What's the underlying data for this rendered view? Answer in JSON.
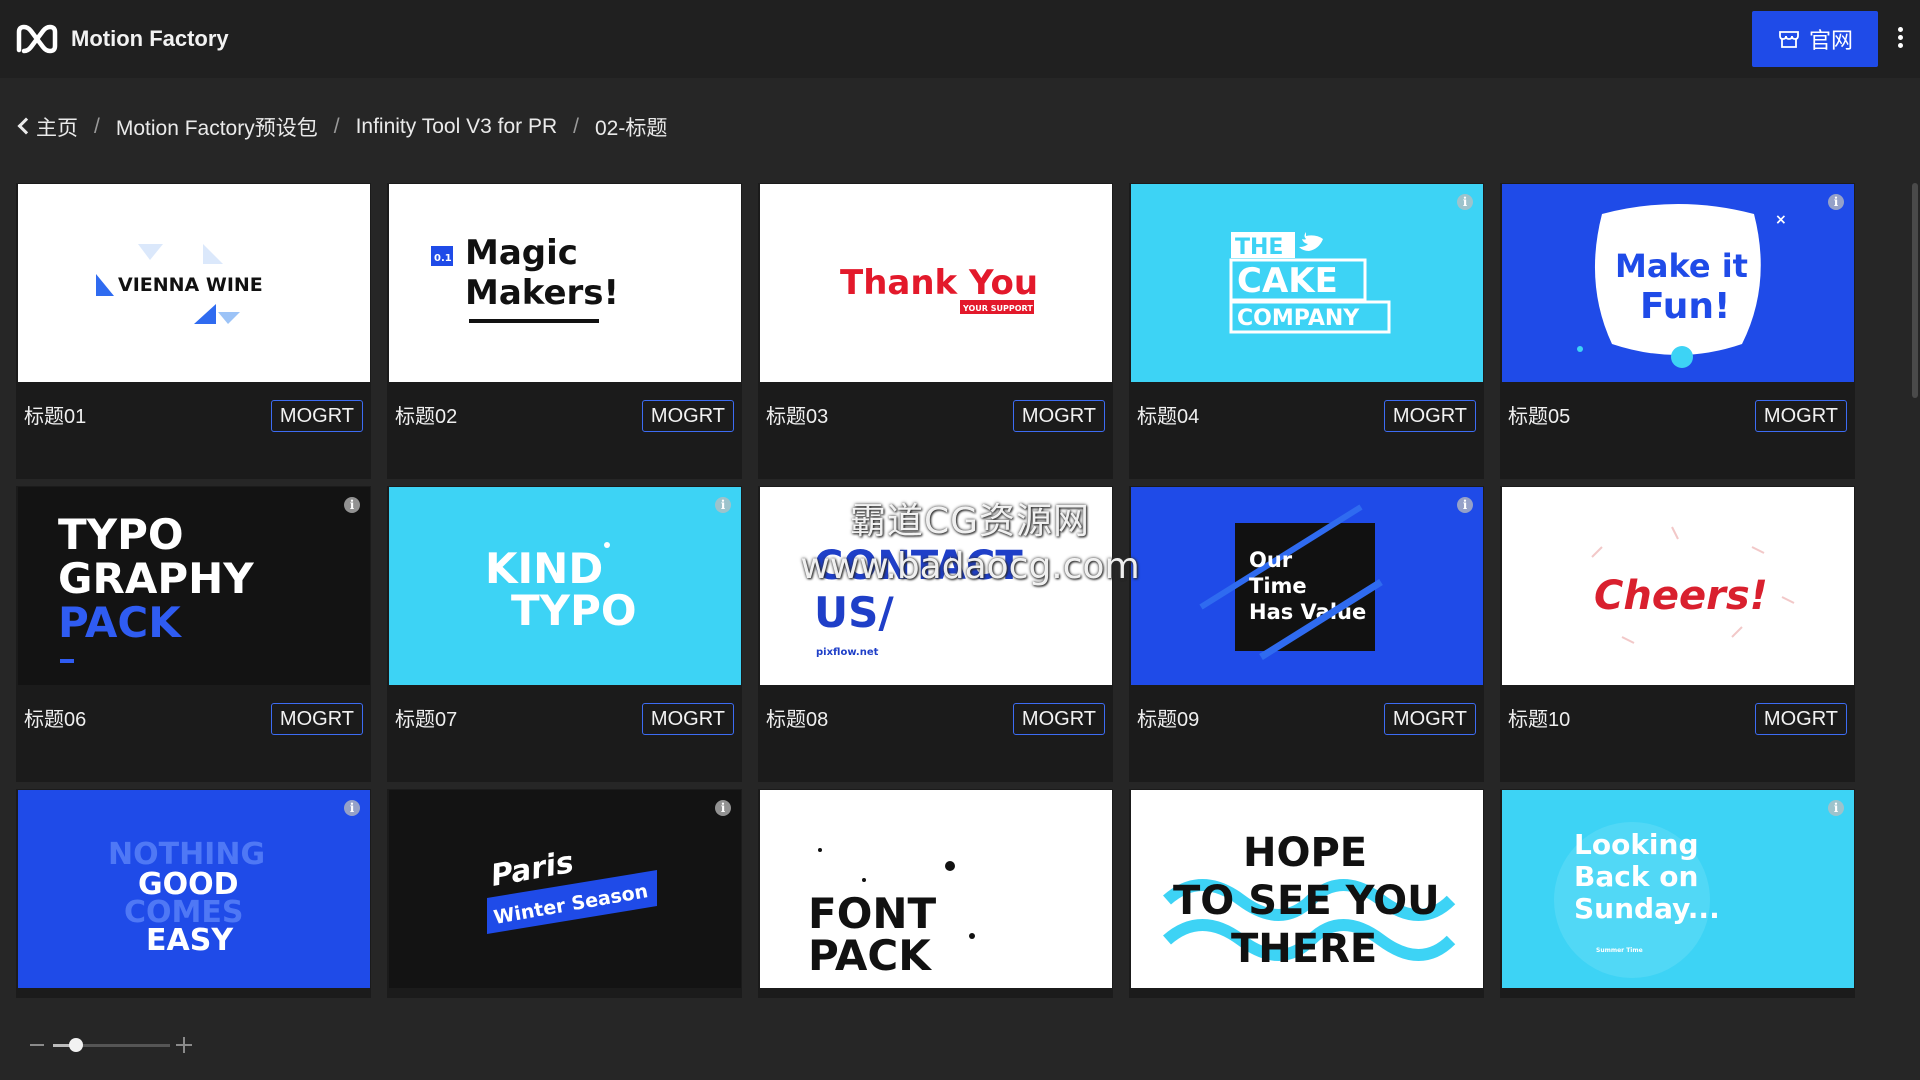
{
  "header": {
    "app_title": "Motion Factory",
    "site_button_label": "官网",
    "accent_color": "#1f4be8"
  },
  "breadcrumb": {
    "items": [
      "主页",
      "Motion Factory预设包",
      "Infinity Tool V3 for PR",
      "02-标题"
    ],
    "separator": "/"
  },
  "grid": {
    "button_label": "MOGRT",
    "cards": [
      {
        "title": "标题01",
        "thumb_text": [
          "VIENNA WINE"
        ],
        "bg": "#ffffff",
        "info_icon": false
      },
      {
        "title": "标题02",
        "thumb_text": [
          "0.1",
          "Magic",
          "Makers!"
        ],
        "bg": "#ffffff",
        "info_icon": false
      },
      {
        "title": "标题03",
        "thumb_text": [
          "Thank You",
          "YOUR SUPPORT"
        ],
        "bg": "#ffffff",
        "info_icon": false
      },
      {
        "title": "标题04",
        "thumb_text": [
          "THE",
          "CAKE",
          "COMPANY"
        ],
        "bg": "#3dd3f5",
        "info_icon": true
      },
      {
        "title": "标题05",
        "thumb_text": [
          "Make it",
          "Fun!"
        ],
        "bg": "#1f4be8",
        "info_icon": true
      },
      {
        "title": "标题06",
        "thumb_text": [
          "TYPO",
          "GRAPHY",
          "PACK"
        ],
        "bg": "#131313",
        "info_icon": true
      },
      {
        "title": "标题07",
        "thumb_text": [
          "KIND",
          "TYPO"
        ],
        "bg": "#3dd3f5",
        "info_icon": true
      },
      {
        "title": "标题08",
        "thumb_text": [
          "CONTACT",
          "US/",
          "pixflow.net"
        ],
        "bg": "#ffffff",
        "info_icon": false
      },
      {
        "title": "标题09",
        "thumb_text": [
          "Our",
          "Time",
          "Has Value"
        ],
        "bg": "#1f4be8",
        "info_icon": true
      },
      {
        "title": "标题10",
        "thumb_text": [
          "Cheers!"
        ],
        "bg": "#ffffff",
        "info_icon": false
      },
      {
        "title": "",
        "thumb_text": [
          "NOTHING",
          "GOOD",
          "COMES",
          "EASY"
        ],
        "bg": "#1f4be8",
        "info_icon": true
      },
      {
        "title": "",
        "thumb_text": [
          "Paris",
          "Winter Season"
        ],
        "bg": "#131313",
        "info_icon": true
      },
      {
        "title": "",
        "thumb_text": [
          "FONT",
          "PACK"
        ],
        "bg": "#ffffff",
        "info_icon": false
      },
      {
        "title": "",
        "thumb_text": [
          "HOPE",
          "TO SEE YOU",
          "THERE"
        ],
        "bg": "#ffffff",
        "info_icon": false
      },
      {
        "title": "",
        "thumb_text": [
          "Looking",
          "Back on",
          "Sunday...",
          "Summer Time"
        ],
        "bg": "#3dd3f5",
        "info_icon": true
      }
    ]
  },
  "zoom": {
    "level": 0.2
  },
  "watermark": {
    "line1": "霸道CG资源网",
    "line2": "www.badaocg.com"
  }
}
